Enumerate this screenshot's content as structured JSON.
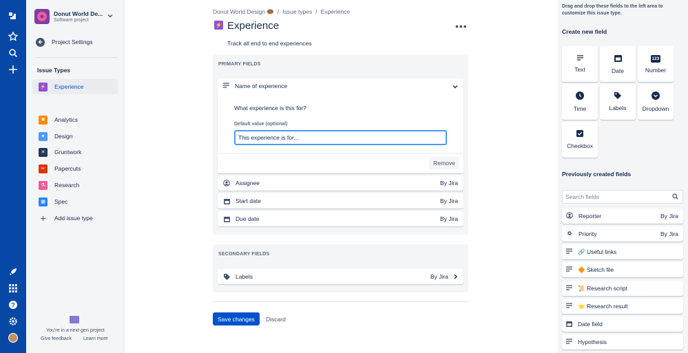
{
  "project": {
    "name": "Donut World De...",
    "type": "Software project",
    "settings_label": "Project Settings"
  },
  "sidebar": {
    "heading": "Issue Types",
    "active_item": "Experience",
    "items": [
      {
        "label": "Analytics",
        "icon": "analytics-icon",
        "color": "#ff8b00"
      },
      {
        "label": "Design",
        "icon": "design-icon",
        "color": "#4c9aff"
      },
      {
        "label": "Gruntwork",
        "icon": "gruntwork-icon",
        "color": "#253858"
      },
      {
        "label": "Papercuts",
        "icon": "papercuts-icon",
        "color": "#de350b"
      },
      {
        "label": "Research",
        "icon": "research-icon",
        "color": "#f15b9a"
      },
      {
        "label": "Spec",
        "icon": "spec-icon",
        "color": "#2684ff"
      }
    ],
    "add_label": "Add issue type",
    "footer_text": "You're in a next-gen project",
    "feedback_link": "Give feedback",
    "learn_link": "Learn more"
  },
  "breadcrumb": {
    "project": "Donut World Design 🍩",
    "issue_types": "Issue types",
    "current": "Experience",
    "separator": "/"
  },
  "page": {
    "title": "Experience",
    "description": "Track all end to end experiences",
    "more": "•••"
  },
  "primary": {
    "label": "PRIMARY FIELDS",
    "expanded_field": {
      "name": "Name of experience",
      "question": "What experience is this for?",
      "default_label": "Default value (optional)",
      "default_value": "This experience is for...",
      "remove_label": "Remove"
    },
    "fields": [
      {
        "name": "Assignee",
        "source": "By Jira",
        "icon": "person-icon"
      },
      {
        "name": "Start date",
        "source": "By Jira",
        "icon": "calendar-icon"
      },
      {
        "name": "Due date",
        "source": "By Jira",
        "icon": "calendar-icon"
      }
    ]
  },
  "secondary": {
    "label": "SECONDARY FIELDS",
    "fields": [
      {
        "name": "Labels",
        "source": "By Jira",
        "icon": "tag-icon"
      }
    ]
  },
  "actions": {
    "save": "Save changes",
    "discard": "Discard"
  },
  "right": {
    "hint": "Drag and drop these fields to the left area to customize this issue type.",
    "create_heading": "Create new field",
    "tiles": [
      {
        "label": "Text",
        "icon": "text-icon"
      },
      {
        "label": "Date",
        "icon": "date-icon"
      },
      {
        "label": "Number",
        "icon": "number-icon",
        "glyph": "123"
      },
      {
        "label": "Time",
        "icon": "time-icon"
      },
      {
        "label": "Labels",
        "icon": "labels-icon"
      },
      {
        "label": "Dropdown",
        "icon": "dropdown-icon"
      },
      {
        "label": "Checkbox",
        "icon": "checkbox-icon"
      }
    ],
    "previous_heading": "Previously created fields",
    "search_placeholder": "Search fields",
    "previous": [
      {
        "name": "Reporter",
        "source": "By Jira",
        "icon": "person-icon"
      },
      {
        "name": "Priority",
        "source": "By Jira",
        "icon": "priority-icon"
      },
      {
        "name": "🔗 Useful links",
        "source": "",
        "icon": "text-icon"
      },
      {
        "name": "🔶 Sketch file",
        "source": "",
        "icon": "text-icon"
      },
      {
        "name": "📜 Research script",
        "source": "",
        "icon": "text-icon"
      },
      {
        "name": "⭐ Research result",
        "source": "",
        "icon": "text-icon"
      },
      {
        "name": "Date field",
        "source": "",
        "icon": "calendar-icon"
      },
      {
        "name": "Hypothesis",
        "source": "",
        "icon": "text-icon"
      }
    ]
  },
  "colors": {
    "nav": "#0747a6",
    "primary_button": "#0052cc",
    "experience_icon": "#904ee2"
  }
}
